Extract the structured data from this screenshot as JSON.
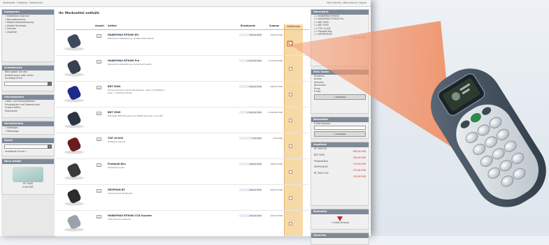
{
  "topbar": {
    "breadcrumb": "Startseite › Katalog › Datenfunk",
    "right_links": "Mein Konto  |  Warenkorb  |  Kasse"
  },
  "left": {
    "categories": {
      "header": "Kategorien",
      "items": [
        "» Datenfunk-Scanner",
        "» Barcodescanner",
        "» Mobile Datenerfassung",
        "» Mobile Terminals",
        "» Drucker",
        "» Zubehör"
      ]
    },
    "quickfind": {
      "header": "Schnellsuche",
      "lines": [
        "Bitte geben Sie den",
        "Artikelnamen oder einen",
        "Suchbegriff ein."
      ]
    },
    "info": {
      "header": "Informationen",
      "lines": [
        "Liefer- und Versandkosten",
        "Privatsphäre und Datenschutz",
        "Unsere AGB's",
        "Impressum"
      ]
    },
    "misc": {
      "header": "Herstellerinfo",
      "lines": [
        "» Datalogic",
        "» Metrologic"
      ]
    },
    "search": {
      "header": "Suche",
      "hint": "erweiterte Suche »"
    },
    "new": {
      "header": "Neue Artikel",
      "caption": "RF 3000",
      "price": "0,00 EUR"
    }
  },
  "main": {
    "title": "Ihr Merkzettel enthält:",
    "columns": {
      "qty": "Anzahl",
      "article": "Artikel",
      "net": "Einzelpreis",
      "gross": "Summe",
      "fav": "Entfernen"
    },
    "products": [
      {
        "name": "HANDYMAX RF3000 Kit",
        "desc": "Datenfunk-Kabellösung, größere Reichweite",
        "desc2": "",
        "qty": "1",
        "net": "799,00 EUR",
        "gross": "799,00 EUR"
      },
      {
        "name": "HANDYMAX RF3000 Pro",
        "desc": "Datenfunk-Kabellösung, kurze Reichweite",
        "desc2": "",
        "qty": "1",
        "net": "1.979,00 EUR",
        "gross": "1.979,00 EUR"
      },
      {
        "name": "BDT 3000",
        "desc": "Handy-Scanner mit Dockingstation, Akku und Batterie",
        "desc2": "Scan- / Speicher-Modus",
        "qty": "1",
        "net": "599,00 EUR",
        "gross": "599,00 EUR"
      },
      {
        "name": "BDT 3500",
        "desc": "Robustes BDT-Terminal mit 256KB Speicher und USB",
        "desc2": "",
        "qty": "1",
        "net": "1.299,00 EUR",
        "gross": "1.299,00 EUR"
      },
      {
        "name": "TOP 10-002",
        "desc": "Software-Lösung",
        "desc2": "",
        "qty": "1",
        "net": "0,00 EUR",
        "gross": "0,00 EUR"
      },
      {
        "name": "Protokoll-Box",
        "desc": "Protokolldrucker",
        "desc2": "",
        "qty": "1",
        "net": "199,00 EUR",
        "gross": "199,00 EUR"
      },
      {
        "name": "GRYPHON BT",
        "desc": "CCD-Scanner Bluetooth",
        "desc2": "",
        "qty": "1",
        "net": "299,00 EUR",
        "gross": "299,00 EUR"
      },
      {
        "name": "HANDYMAX RF3000 CCD Scanner",
        "desc": "CCD-Scanner kabellos",
        "desc2": "",
        "qty": "1",
        "net": "249,00 EUR",
        "gross": "249,00 EUR"
      }
    ]
  },
  "right": {
    "cart": {
      "header": "Warenkorb",
      "lines": [
        "1 x  HANDYMAX RF3000",
        "1 x  HANDYMAX RF3000 Pro",
        "1 x  BDT 3000",
        "1 x  BDT 3500",
        "1 x  TOP 10-002",
        "1 x  Protokoll-Box",
        "1 x  GRYPHON BT"
      ],
      "total": "5.424,00 EUR"
    },
    "account": {
      "header": "Mein Konto",
      "lines": [
        "Kundennr.",
        "Anrede",
        "Vorname",
        "Nachname",
        "Firma",
        "E-Mail"
      ],
      "button": "» Abmelden"
    },
    "newsletter": {
      "header": "Newsletter",
      "lines": [
        "E-Mail-Adresse:"
      ],
      "button": "» Anmelden"
    },
    "offers": {
      "header": "Angebote",
      "lines": [
        "RF 3000 Kit",
        "BDT 3000",
        "Protokoll-Box",
        "GRYPHON BT",
        "RF 3000 CCD"
      ],
      "prices": [
        "699,00 EUR",
        "549,00 EUR",
        "179,00 EUR",
        "279,00 EUR",
        "229,00 EUR"
      ]
    },
    "bestseller": {
      "header": "Bestseller",
      "caption": "» Gratis Versand"
    },
    "lang": {
      "header": "Sprachen"
    }
  },
  "colors": {
    "header_bar": "#7f8a98",
    "favorite_column": "#f7d9a8",
    "beam": "#f08c60",
    "device_body": "#4a5868"
  },
  "icons": [
    "search-icon",
    "go-arrow-icon",
    "scanner-device-icon"
  ]
}
